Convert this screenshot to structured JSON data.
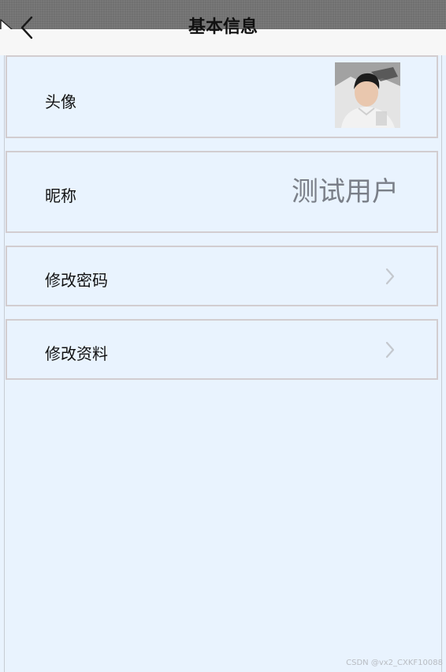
{
  "header": {
    "title": "基本信息"
  },
  "rows": {
    "avatar": {
      "label": "头像"
    },
    "nickname": {
      "label": "昵称",
      "value": "测试用户"
    },
    "change_password": {
      "label": "修改密码"
    },
    "edit_profile": {
      "label": "修改资料"
    }
  },
  "footer": {
    "watermark": "CSDN @vx2_CXKF10088"
  },
  "colors": {
    "background": "#e9f3fe",
    "row_border": "#d2cdd0",
    "value_text": "#7a7f88",
    "top_bar": "#707070"
  }
}
